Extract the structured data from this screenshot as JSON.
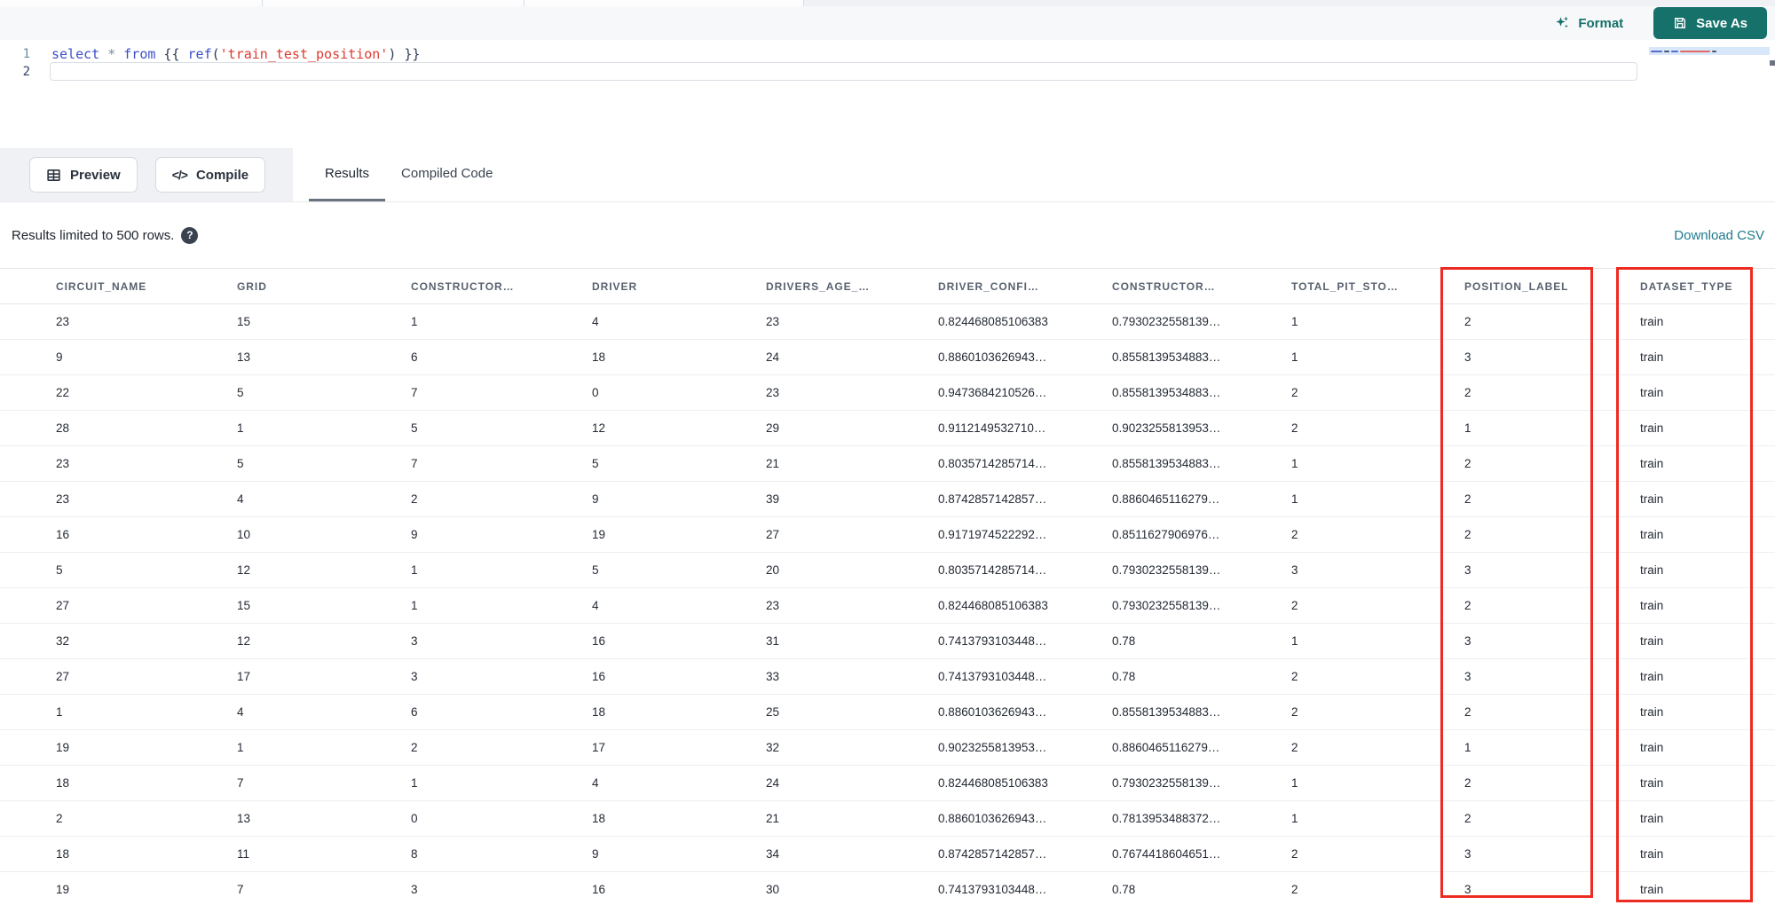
{
  "accent": {
    "teal": "#15716a",
    "link_teal": "#1e7a8d",
    "annotation_red": "#ee2b22"
  },
  "toolbar": {
    "format_label": "Format",
    "save_as_label": "Save As"
  },
  "editor": {
    "lines": [
      {
        "number": "1"
      },
      {
        "number": "2"
      }
    ],
    "code_tokens": [
      {
        "text": "select",
        "type": "kw"
      },
      {
        "text": " ",
        "type": "pl"
      },
      {
        "text": "*",
        "type": "op"
      },
      {
        "text": " ",
        "type": "pl"
      },
      {
        "text": "from",
        "type": "kw"
      },
      {
        "text": " {{ ",
        "type": "pl"
      },
      {
        "text": "ref",
        "type": "kw"
      },
      {
        "text": "(",
        "type": "pl"
      },
      {
        "text": "'train_test_position'",
        "type": "str"
      },
      {
        "text": ")",
        "type": "pl"
      },
      {
        "text": " }}",
        "type": "pl"
      }
    ]
  },
  "actions": {
    "preview_label": "Preview",
    "compile_label": "Compile",
    "compile_glyph": "</>"
  },
  "tabs": [
    {
      "label": "Results",
      "active": true
    },
    {
      "label": "Compiled Code",
      "active": false
    }
  ],
  "results_info": {
    "limit_text": "Results limited to 500 rows.",
    "help_glyph": "?",
    "download_label": "Download CSV"
  },
  "table": {
    "columns": [
      "CIRCUIT_NAME",
      "GRID",
      "CONSTRUCTOR…",
      "DRIVER",
      "DRIVERS_AGE_…",
      "DRIVER_CONFI…",
      "CONSTRUCTOR…",
      "TOTAL_PIT_STO…",
      "POSITION_LABEL",
      "DATASET_TYPE"
    ],
    "rows": [
      [
        "23",
        "15",
        "1",
        "4",
        "23",
        "0.824468085106383",
        "0.7930232558139…",
        "1",
        "2",
        "train"
      ],
      [
        "9",
        "13",
        "6",
        "18",
        "24",
        "0.8860103626943…",
        "0.8558139534883…",
        "1",
        "3",
        "train"
      ],
      [
        "22",
        "5",
        "7",
        "0",
        "23",
        "0.9473684210526…",
        "0.8558139534883…",
        "2",
        "2",
        "train"
      ],
      [
        "28",
        "1",
        "5",
        "12",
        "29",
        "0.9112149532710…",
        "0.9023255813953…",
        "2",
        "1",
        "train"
      ],
      [
        "23",
        "5",
        "7",
        "5",
        "21",
        "0.8035714285714…",
        "0.8558139534883…",
        "1",
        "2",
        "train"
      ],
      [
        "23",
        "4",
        "2",
        "9",
        "39",
        "0.8742857142857…",
        "0.8860465116279…",
        "1",
        "2",
        "train"
      ],
      [
        "16",
        "10",
        "9",
        "19",
        "27",
        "0.9171974522292…",
        "0.8511627906976…",
        "2",
        "2",
        "train"
      ],
      [
        "5",
        "12",
        "1",
        "5",
        "20",
        "0.8035714285714…",
        "0.7930232558139…",
        "3",
        "3",
        "train"
      ],
      [
        "27",
        "15",
        "1",
        "4",
        "23",
        "0.824468085106383",
        "0.7930232558139…",
        "2",
        "2",
        "train"
      ],
      [
        "32",
        "12",
        "3",
        "16",
        "31",
        "0.7413793103448…",
        "0.78",
        "1",
        "3",
        "train"
      ],
      [
        "27",
        "17",
        "3",
        "16",
        "33",
        "0.7413793103448…",
        "0.78",
        "2",
        "3",
        "train"
      ],
      [
        "1",
        "4",
        "6",
        "18",
        "25",
        "0.8860103626943…",
        "0.8558139534883…",
        "2",
        "2",
        "train"
      ],
      [
        "19",
        "1",
        "2",
        "17",
        "32",
        "0.9023255813953…",
        "0.8860465116279…",
        "2",
        "1",
        "train"
      ],
      [
        "18",
        "7",
        "1",
        "4",
        "24",
        "0.824468085106383",
        "0.7930232558139…",
        "1",
        "2",
        "train"
      ],
      [
        "2",
        "13",
        "0",
        "18",
        "21",
        "0.8860103626943…",
        "0.7813953488372…",
        "1",
        "2",
        "train"
      ],
      [
        "18",
        "11",
        "8",
        "9",
        "34",
        "0.8742857142857…",
        "0.7674418604651…",
        "2",
        "3",
        "train"
      ],
      [
        "19",
        "7",
        "3",
        "16",
        "30",
        "0.7413793103448…",
        "0.78",
        "2",
        "3",
        "train"
      ]
    ],
    "annotations": {
      "highlighted_columns": [
        "POSITION_LABEL",
        "DATASET_TYPE"
      ]
    }
  }
}
